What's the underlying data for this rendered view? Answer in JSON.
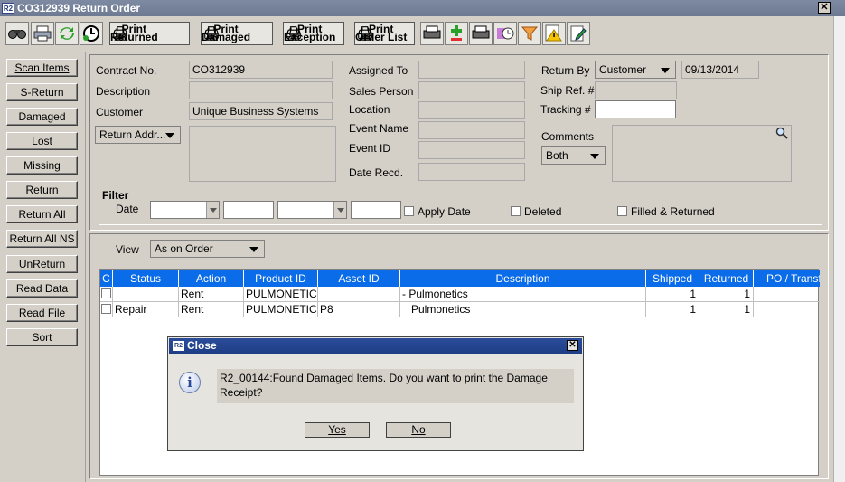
{
  "window": {
    "title": "CO312939 Return Order",
    "app_badge": "R2",
    "close_glyph": "✕"
  },
  "toolbar": {
    "icons": [
      "binoculars-icon",
      "printer-icon",
      "refresh-icon",
      "clock-icon",
      "print-lines-icon",
      "add-icon",
      "print-doc-icon",
      "schedule-icon",
      "filter-icon",
      "warning-icon",
      "edit-icon"
    ],
    "print_returned": [
      "Print",
      "Returned"
    ],
    "print_damaged": [
      "Print",
      "Damaged"
    ],
    "print_exception": [
      "Print",
      "Exception"
    ],
    "print_order_list": [
      "Print",
      "Order List"
    ]
  },
  "left_buttons": [
    "Scan Items",
    "S-Return",
    "Damaged",
    "Lost",
    "Missing",
    "Return",
    "Return All",
    "Return All NS",
    "UnReturn",
    "Read Data",
    "Read File",
    "Sort"
  ],
  "header": {
    "contract_no_label": "Contract No.",
    "contract_no": "CO312939",
    "description_label": "Description",
    "description": "",
    "customer_label": "Customer",
    "customer": "Unique Business Systems",
    "return_addr": "Return Addr...",
    "assigned_to_label": "Assigned To",
    "sales_person_label": "Sales Person",
    "location_label": "Location",
    "event_name_label": "Event Name",
    "event_id_label": "Event ID",
    "date_recd_label": "Date Recd.",
    "return_by_label": "Return By",
    "return_by": "Customer",
    "return_date": "09/13/2014",
    "ship_ref_label": "Ship Ref. #",
    "tracking_label": "Tracking #",
    "comments_label": "Comments",
    "comments_scope": "Both"
  },
  "filter": {
    "title": "Filter",
    "date_label": "Date",
    "apply_date": "Apply Date",
    "deleted": "Deleted",
    "filled_returned": "Filled & Returned"
  },
  "view": {
    "label": "View",
    "value": "As on Order"
  },
  "table": {
    "columns": [
      "C",
      "Status",
      "Action",
      "Product ID",
      "Asset ID",
      "Description",
      "Shipped",
      "Returned",
      "PO / Transfer"
    ],
    "rows": [
      {
        "c": "",
        "status": "",
        "action": "Rent",
        "product_id": "PULMONETICS",
        "asset_id": "",
        "description": "- Pulmonetics",
        "shipped": "1",
        "returned": "1",
        "po": ""
      },
      {
        "c": "",
        "status": "Repair",
        "action": "Rent",
        "product_id": "PULMONETICS",
        "asset_id": "P8",
        "description": "Pulmonetics",
        "shipped": "1",
        "returned": "1",
        "po": ""
      }
    ]
  },
  "dialog": {
    "title": "Close",
    "message": "R2_00144:Found Damaged Items. Do you want to print the Damage Receipt?",
    "yes": "Yes",
    "no": "No",
    "info_glyph": "i"
  }
}
